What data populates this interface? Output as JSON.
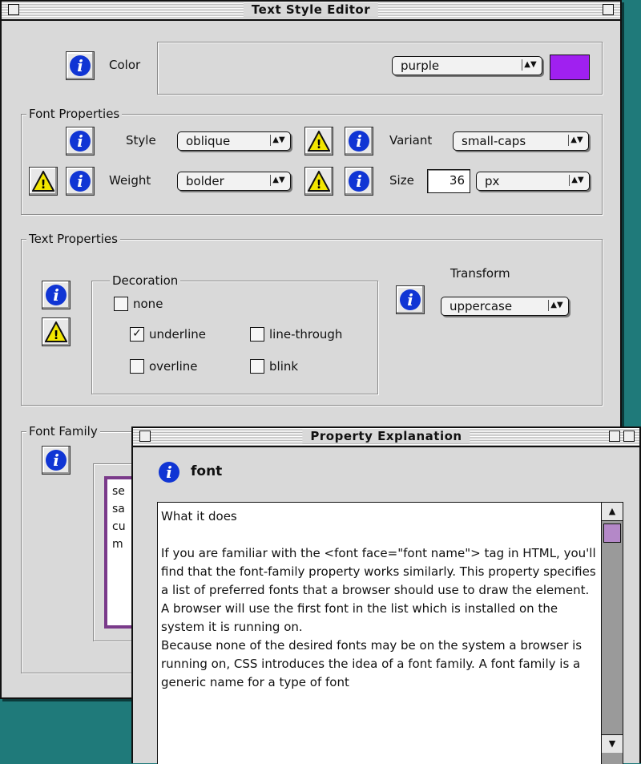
{
  "main_window": {
    "title": "Text Style Editor",
    "color": {
      "label": "Color",
      "value": "purple",
      "swatch_color": "#a020f0"
    },
    "font_properties": {
      "label": "Font Properties",
      "style": {
        "label": "Style",
        "value": "oblique"
      },
      "variant": {
        "label": "Variant",
        "value": "small-caps"
      },
      "weight": {
        "label": "Weight",
        "value": "bolder"
      },
      "size": {
        "label": "Size",
        "value": "36",
        "unit": "px"
      }
    },
    "text_properties": {
      "label": "Text Properties",
      "decoration": {
        "label": "Decoration",
        "options": [
          {
            "label": "none",
            "checked": false
          },
          {
            "label": "underline",
            "checked": true
          },
          {
            "label": "line-through",
            "checked": false
          },
          {
            "label": "overline",
            "checked": false
          },
          {
            "label": "blink",
            "checked": false
          }
        ]
      },
      "transform": {
        "label": "Transform",
        "value": "uppercase"
      }
    },
    "font_family": {
      "label": "Font Family",
      "list_fragments": [
        "se",
        "sa",
        "cu",
        "m"
      ]
    }
  },
  "explanation_window": {
    "title": "Property Explanation",
    "property_name": "font",
    "text": "What it does\n\nIf you are familiar with the <font face=\"font name\"> tag in HTML, you'll find that the font-family property works similarly. This property specifies a list of preferred fonts that a browser should use to draw the element.\nA browser will use the first font in the list which is installed on the system it is running on.\nBecause none of the desired fonts may be on the system a browser is running on, CSS introduces the idea of a font family. A font family is a generic name for a type of font"
  },
  "icons": {
    "info": "info-icon",
    "warning": "warning-icon"
  },
  "colors": {
    "desktop": "#1f7a7a",
    "window_bg": "#d9d9d9",
    "info_blue": "#1035d4",
    "warning_yellow": "#f2e600"
  }
}
